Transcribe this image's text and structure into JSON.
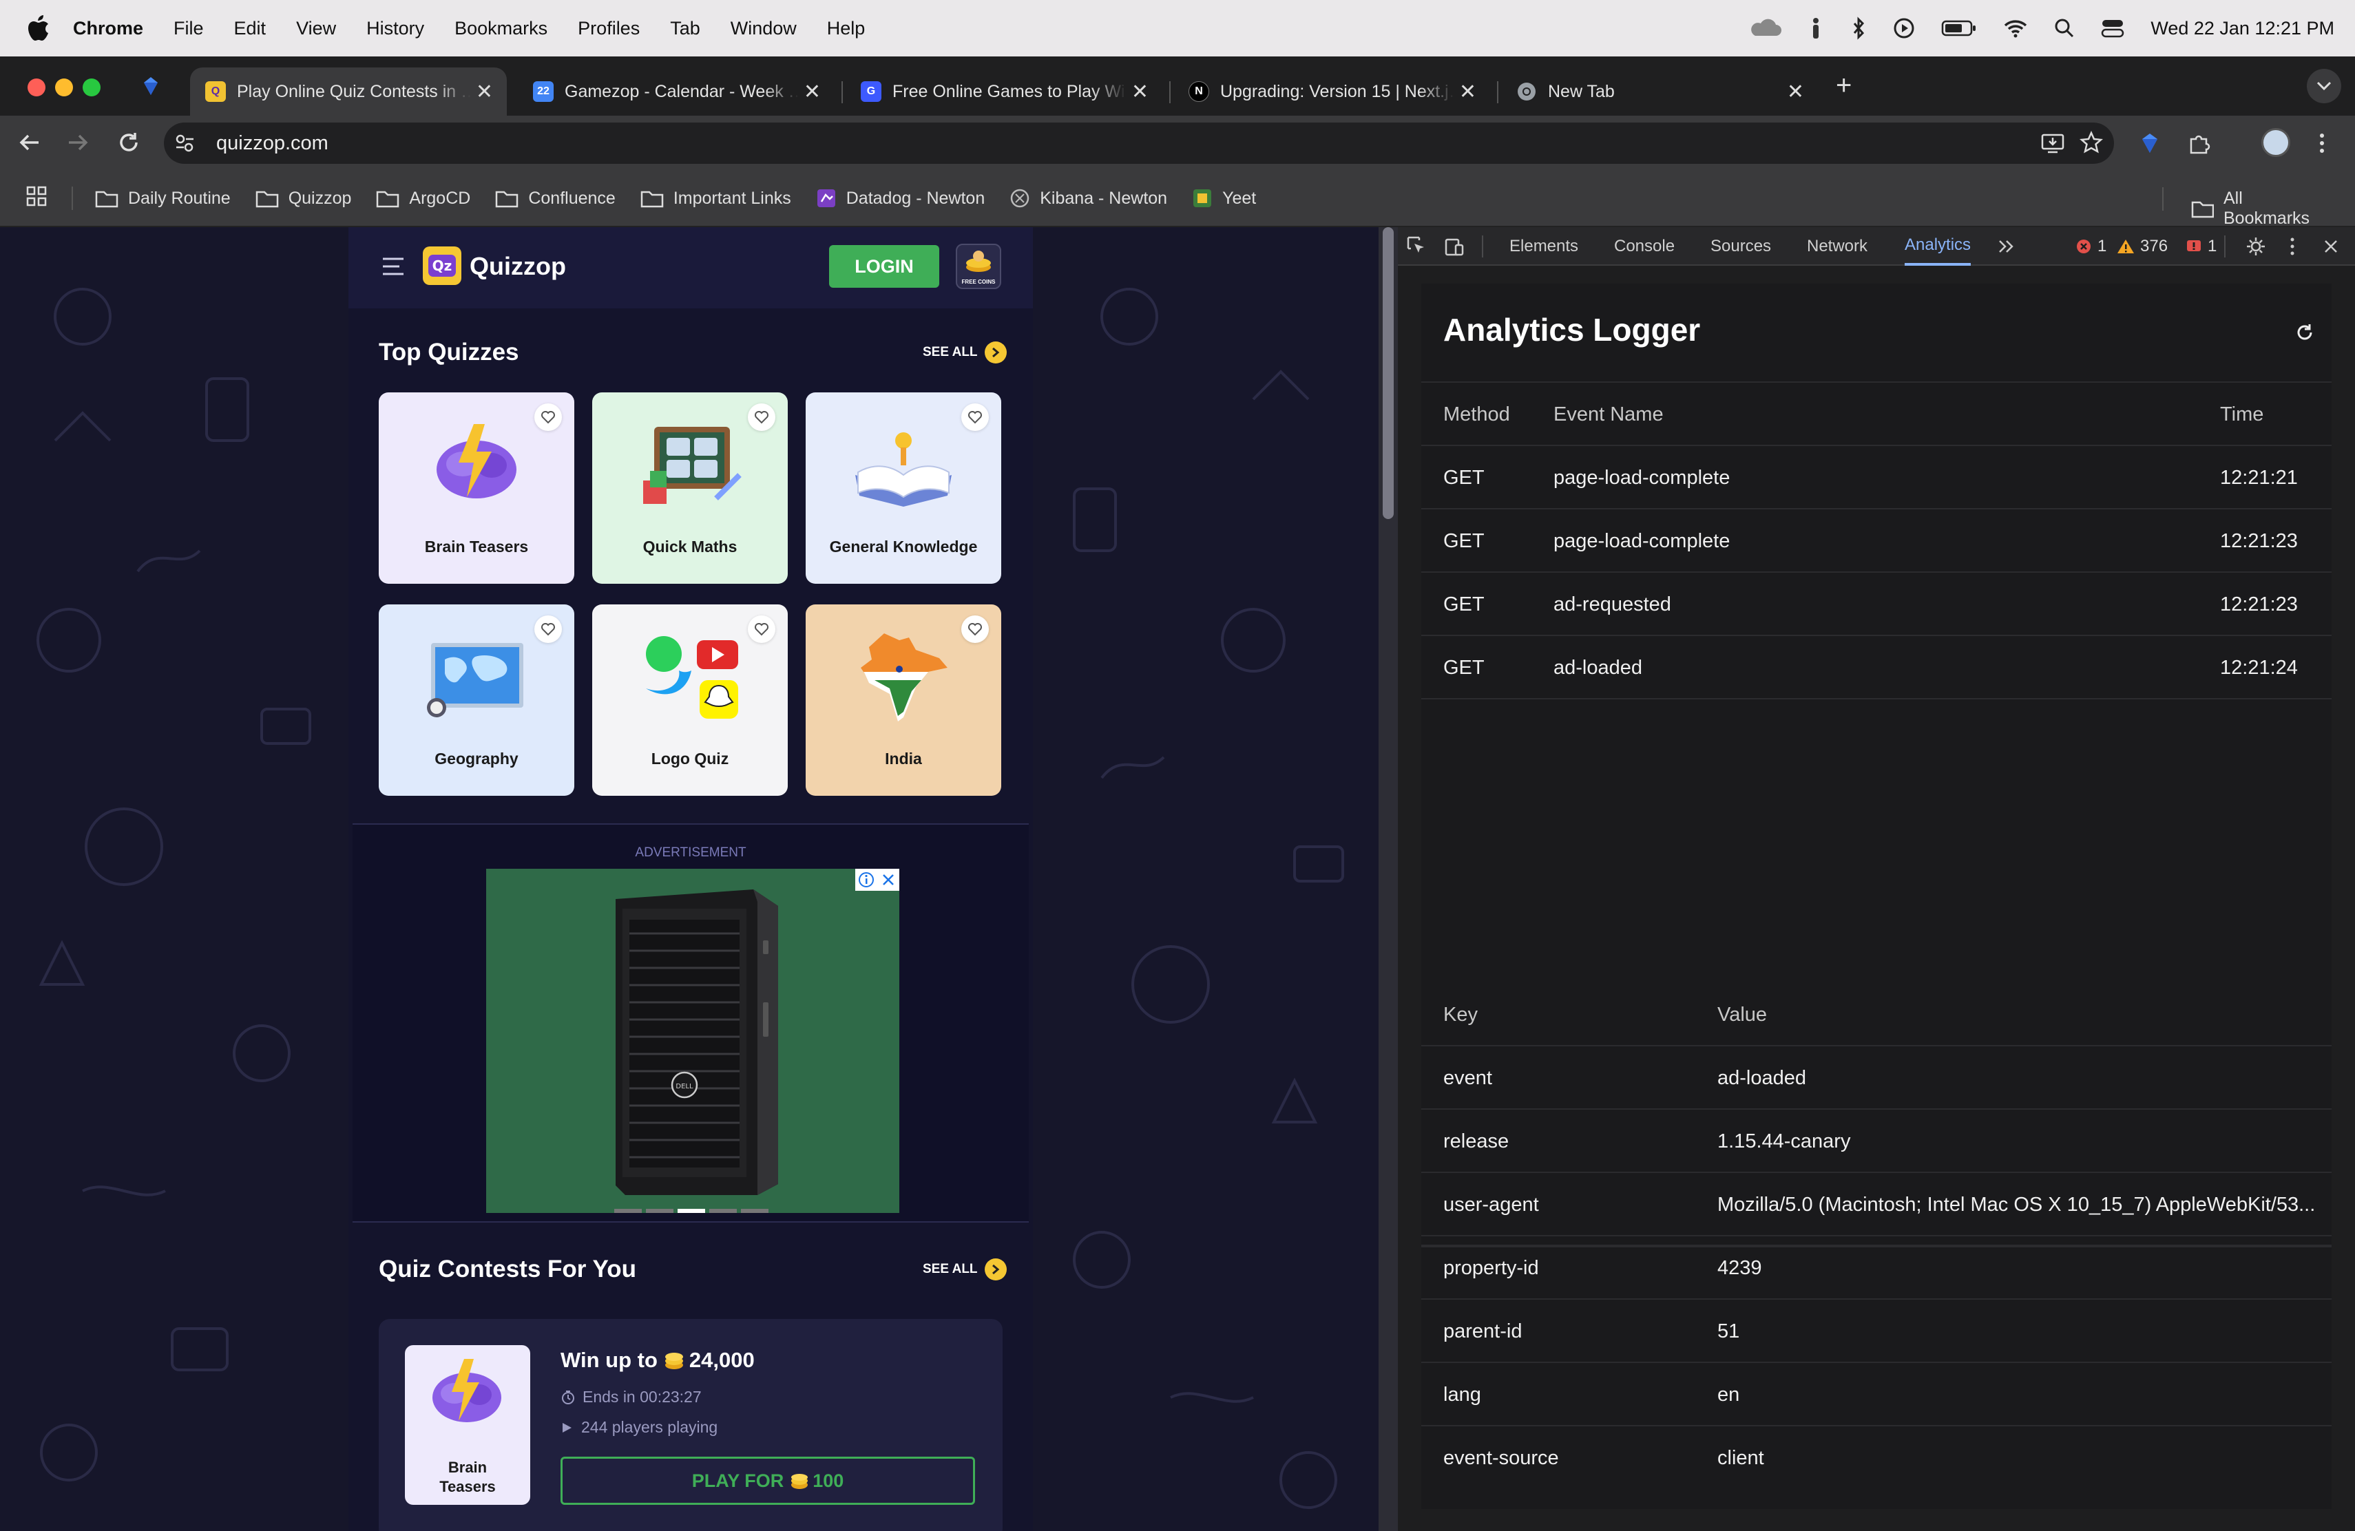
{
  "menubar": {
    "app_name": "Chrome",
    "items": [
      "File",
      "Edit",
      "View",
      "History",
      "Bookmarks",
      "Profiles",
      "Tab",
      "Window",
      "Help"
    ],
    "clock": "Wed 22 Jan  12:21 PM"
  },
  "tabs": [
    {
      "title": "Play Online Quiz Contests in …",
      "active": true
    },
    {
      "title": "Gamezop - Calendar - Week …",
      "active": false
    },
    {
      "title": "Free Online Games to Play Wi…",
      "active": false
    },
    {
      "title": "Upgrading: Version 15 | Next.j…",
      "active": false
    },
    {
      "title": "New Tab",
      "active": false
    }
  ],
  "omnibox": {
    "url": "quizzop.com"
  },
  "bookmarks": {
    "items": [
      "Daily Routine",
      "Quizzop",
      "ArgoCD",
      "Confluence",
      "Important Links",
      "Datadog - Newton",
      "Kibana - Newton",
      "Yeet"
    ],
    "all": "All Bookmarks"
  },
  "site": {
    "brand": "Quizzop",
    "login": "LOGIN",
    "coin_badge": "FREE COINS",
    "top_title": "Top Quizzes",
    "see_all": "SEE ALL",
    "quizzes": [
      "Brain Teasers",
      "Quick Maths",
      "General Knowledge",
      "Geography",
      "Logo Quiz",
      "India"
    ],
    "ad_label": "ADVERTISEMENT",
    "contests_title": "Quiz Contests For You",
    "contest": {
      "card_label": "Brain Teasers",
      "win_prefix": "Win up to",
      "prize": "24,000",
      "ends": "Ends in 00:23:27",
      "players": "244 players playing",
      "play_prefix": "PLAY FOR",
      "cost": "100"
    }
  },
  "devtools": {
    "tabs": [
      "Elements",
      "Console",
      "Sources",
      "Network",
      "Analytics"
    ],
    "errors": "1",
    "warnings": "376",
    "issues": "1",
    "panel_title": "Analytics Logger",
    "headers": {
      "method": "Method",
      "event": "Event Name",
      "time": "Time"
    },
    "events": [
      {
        "method": "GET",
        "event": "page-load-complete",
        "time": "12:21:21"
      },
      {
        "method": "GET",
        "event": "page-load-complete",
        "time": "12:21:23"
      },
      {
        "method": "GET",
        "event": "ad-requested",
        "time": "12:21:23"
      },
      {
        "method": "GET",
        "event": "ad-loaded",
        "time": "12:21:24"
      }
    ],
    "kv_headers": {
      "key": "Key",
      "value": "Value"
    },
    "details": [
      {
        "key": "event",
        "value": "ad-loaded"
      },
      {
        "key": "release",
        "value": "1.15.44-canary"
      },
      {
        "key": "user-agent",
        "value": "Mozilla/5.0 (Macintosh; Intel Mac OS X 10_15_7) AppleWebKit/53..."
      },
      {
        "key": "property-id",
        "value": "4239"
      },
      {
        "key": "parent-id",
        "value": "51"
      },
      {
        "key": "lang",
        "value": "en"
      },
      {
        "key": "event-source",
        "value": "client"
      }
    ]
  },
  "colors": {
    "accent_green": "#3fae57",
    "analytics_active": "#8ab4f8",
    "quiz_purple": "#eeeafc"
  }
}
